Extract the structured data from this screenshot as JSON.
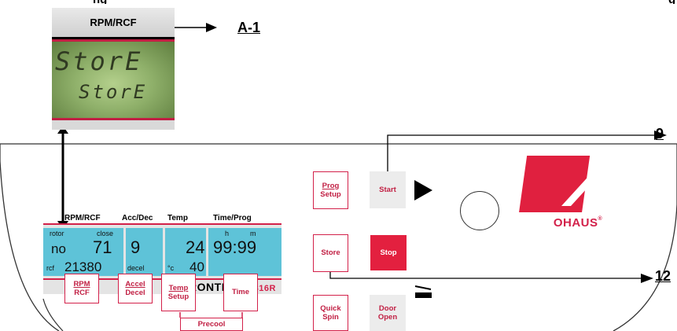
{
  "caption_top": {
    "fragments": [
      "ng",
      "g"
    ]
  },
  "inset": {
    "header": "RPM/RCF",
    "lcd_line1": "StorE",
    "lcd_line2": "StorE"
  },
  "callouts": {
    "a1": "A-1",
    "nine": "9",
    "twelve": "12"
  },
  "display": {
    "headers": {
      "rpm_rcf": "RPM/RCF",
      "acc_dec": "Acc/Dec",
      "temp": "Temp",
      "time_prog": "Time/Prog"
    },
    "rotor_label": "rotor",
    "close_label": "close",
    "rotor_value": "no",
    "rpm_value": "71",
    "rcf_label": "rcf",
    "rcf_value": "21380",
    "acc_value": "9",
    "decel_label": "decel",
    "temp_value": "24",
    "temp_unit": "°c",
    "temp_set": "40",
    "h_label": "h",
    "m_label": "m",
    "time_value": "99:99"
  },
  "brand": {
    "name": "FRONTIER",
    "tm": "™",
    "model": "5816R"
  },
  "keys": {
    "rpm": [
      "RPM",
      "RCF"
    ],
    "accel": [
      "Accel",
      "Decel"
    ],
    "temp": [
      "Temp",
      "Setup"
    ],
    "time": "Time",
    "precool": "Precool",
    "prog": [
      "Prog",
      "Setup"
    ],
    "start": "Start",
    "store": "Store",
    "stop": "Stop",
    "quick": [
      "Quick",
      "Spin"
    ],
    "door": [
      "Door",
      "Open"
    ]
  },
  "logo": {
    "text": "OHAUS",
    "reg": "®"
  },
  "colors": {
    "accent": "#d3214a",
    "lcd_blue": "#5ec3d8",
    "lcd_green": "#8fb06a"
  }
}
